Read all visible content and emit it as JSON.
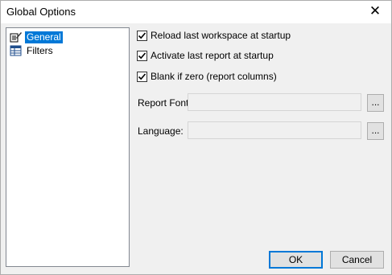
{
  "window": {
    "title": "Global Options"
  },
  "tree": {
    "items": [
      {
        "label": "General",
        "selected": true,
        "icon": "general-options-icon"
      },
      {
        "label": "Filters",
        "selected": false,
        "icon": "filter-table-icon"
      }
    ]
  },
  "options": {
    "checkboxes": [
      {
        "label": "Reload last workspace at startup",
        "checked": true
      },
      {
        "label": "Activate last report at startup",
        "checked": true
      },
      {
        "label": "Blank if zero (report columns)",
        "checked": true
      }
    ],
    "report_font": {
      "label": "Report Font:",
      "value": "",
      "browse_label": "..."
    },
    "language": {
      "label": "Language:",
      "value": "",
      "browse_label": "..."
    }
  },
  "buttons": {
    "ok_label": "OK",
    "cancel_label": "Cancel"
  },
  "colors": {
    "selection": "#0078d7",
    "window_bg": "#f0f0f0"
  }
}
